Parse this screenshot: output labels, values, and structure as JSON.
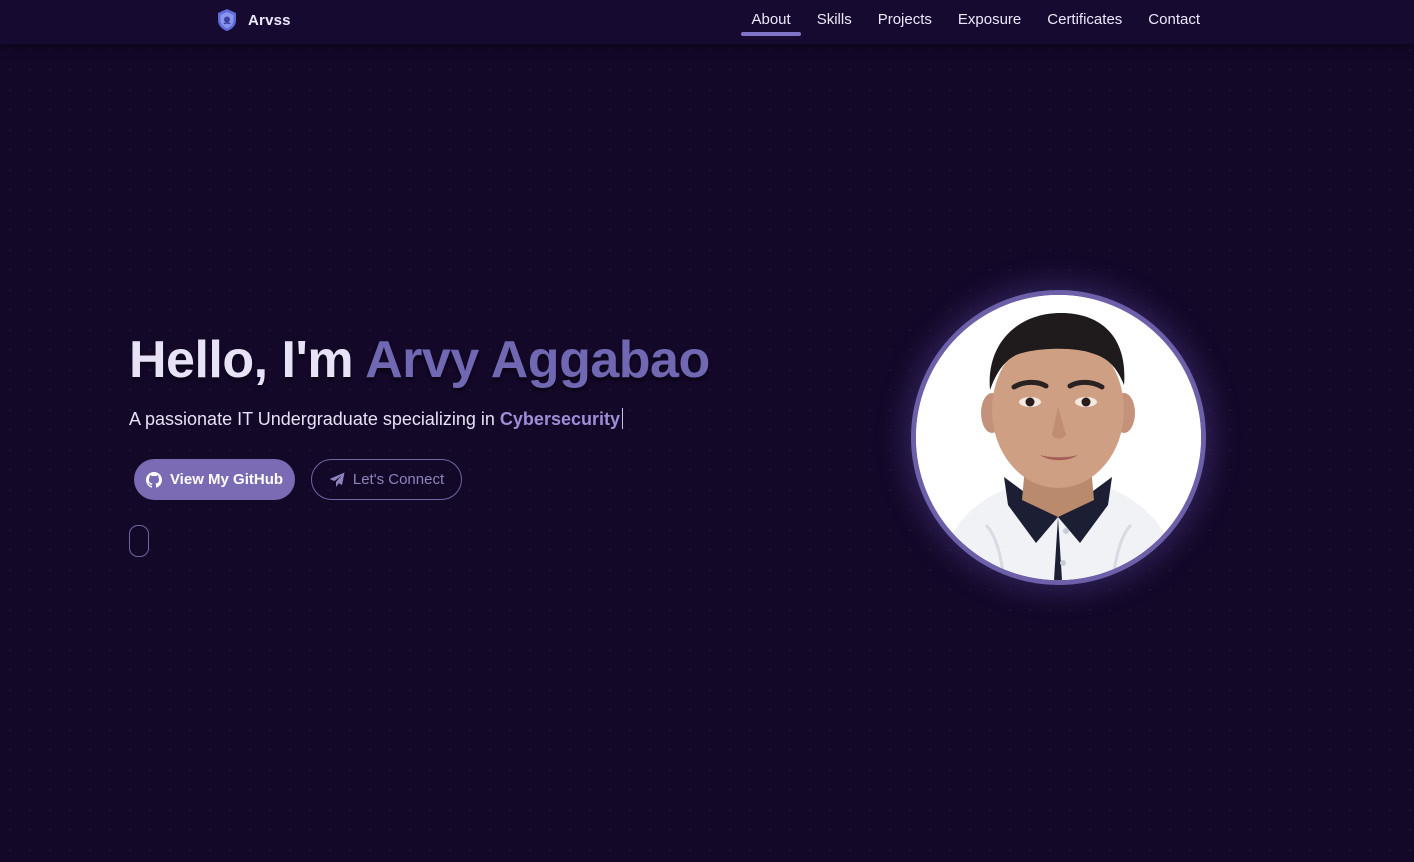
{
  "brand": {
    "name": "Arvss",
    "icon": "shield-icon"
  },
  "nav": {
    "items": [
      {
        "label": "About",
        "active": true
      },
      {
        "label": "Skills"
      },
      {
        "label": "Projects"
      },
      {
        "label": "Exposure"
      },
      {
        "label": "Certificates"
      },
      {
        "label": "Contact"
      }
    ]
  },
  "hero": {
    "greeting": "Hello, I'm",
    "name": "Arvy Aggabao",
    "subtitle_prefix": "A passionate IT Undergraduate specializing in",
    "subtitle_highlight": "Cybersecurity",
    "buttons": {
      "github": {
        "label": "View My GitHub",
        "icon": "github-icon"
      },
      "connect": {
        "label": "Let's Connect",
        "icon": "send-icon"
      }
    },
    "profile_photo": "portrait-photo"
  },
  "colors": {
    "background": "#130828",
    "navbar": "#170a31",
    "accent": "#7b6bb4",
    "name_highlight": "#7068b3",
    "subtitle_highlight": "#9f8dd8"
  }
}
